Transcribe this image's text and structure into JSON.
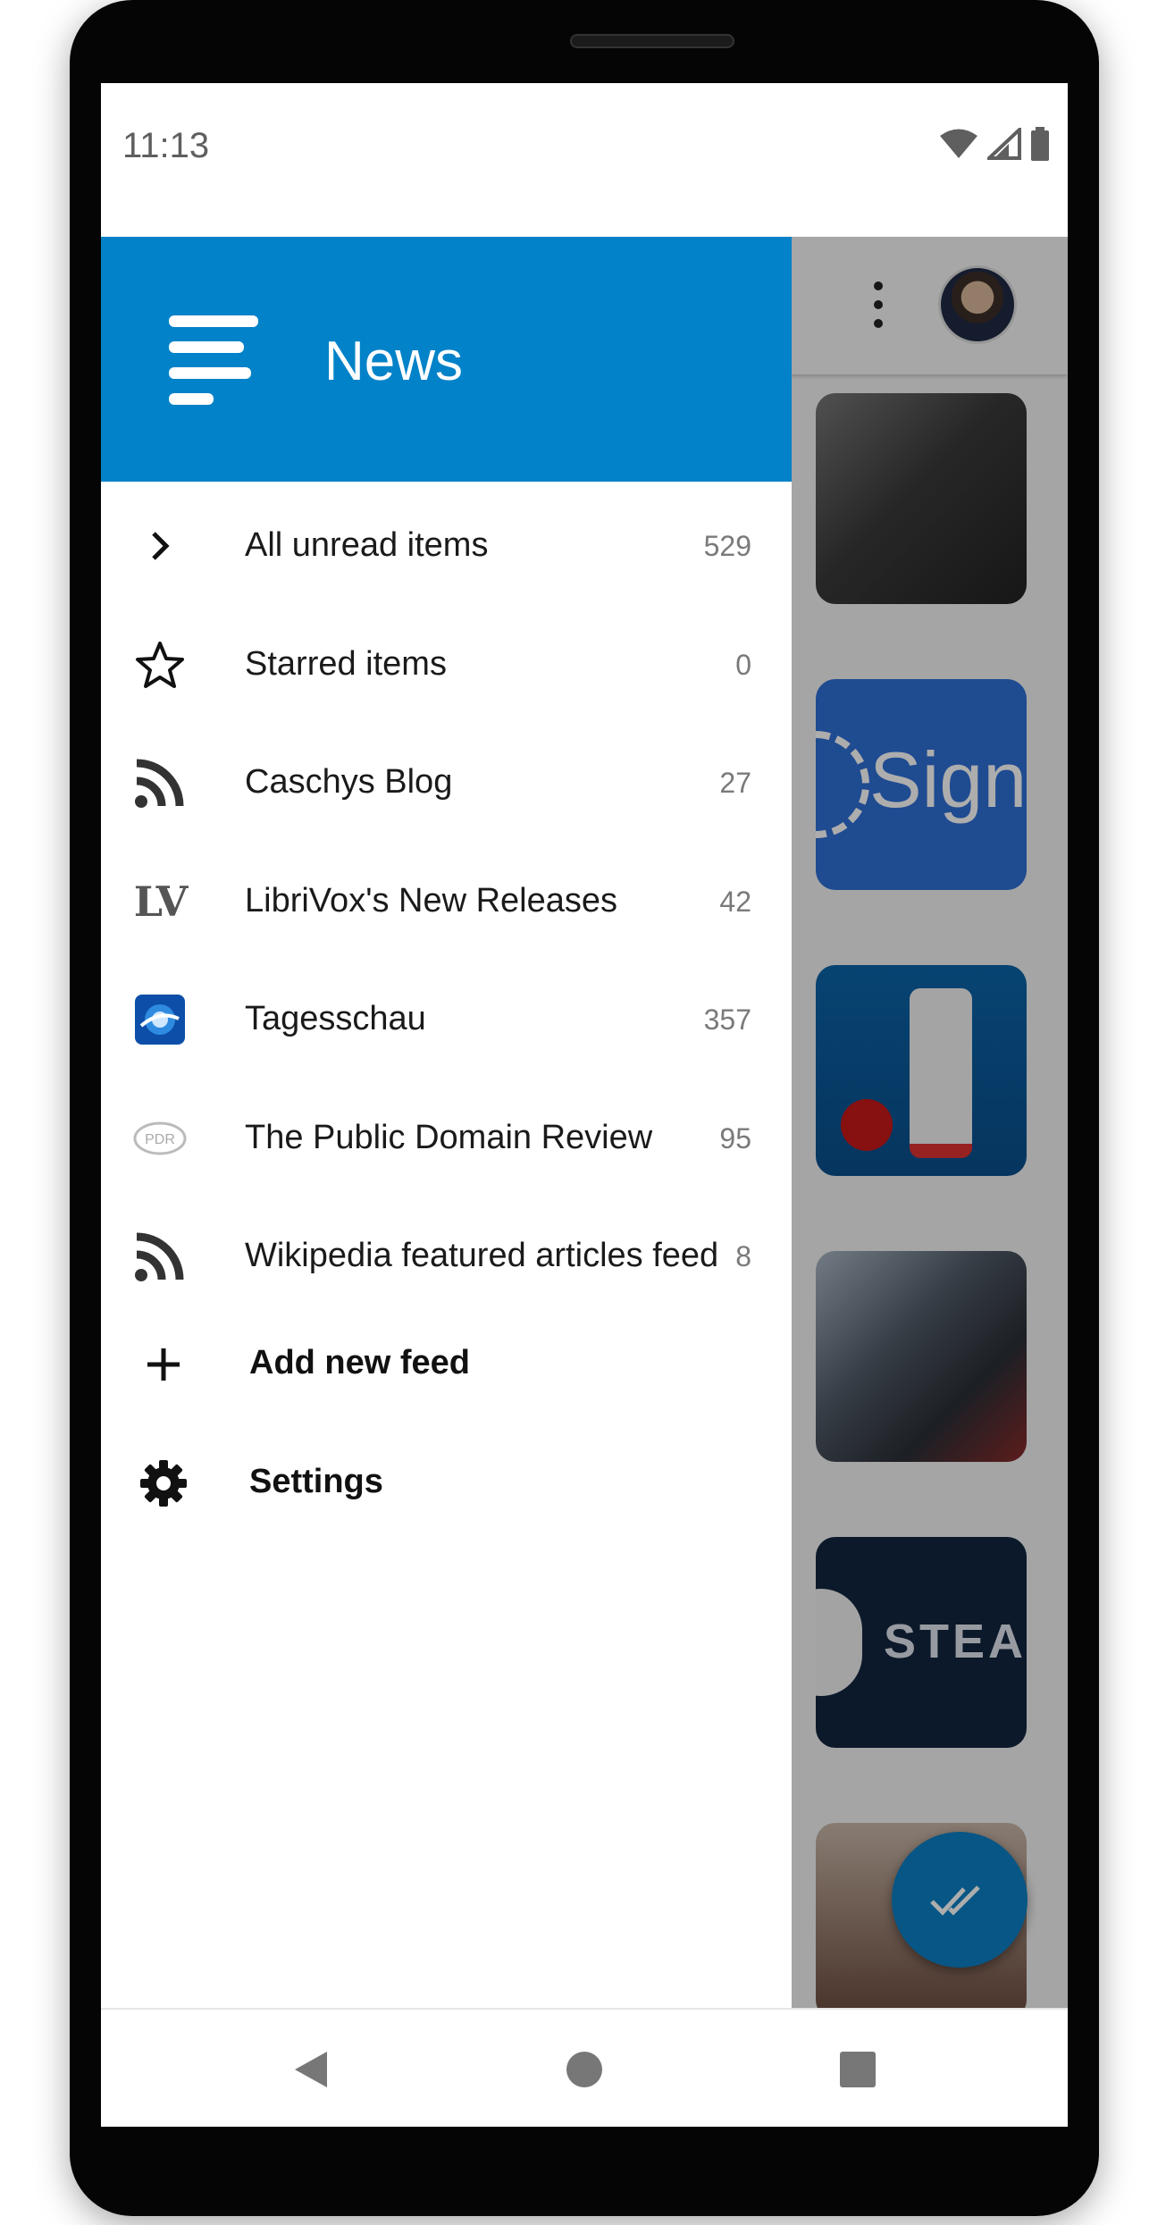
{
  "status_bar": {
    "time": "11:13"
  },
  "drawer": {
    "app_title": "News",
    "feeds": [
      {
        "icon": "chevron-right-icon",
        "label": "All unread items",
        "count": "529"
      },
      {
        "icon": "star-outline-icon",
        "label": "Starred items",
        "count": "0"
      },
      {
        "icon": "rss-icon",
        "label": "Caschys Blog",
        "count": "27"
      },
      {
        "icon": "librivox-logo-icon",
        "label": "LibriVox's New Releases",
        "count": "42",
        "icon_text": "LV"
      },
      {
        "icon": "tagesschau-logo-icon",
        "label": "Tagesschau",
        "count": "357"
      },
      {
        "icon": "public-domain-review-logo-icon",
        "label": "The Public Domain Review",
        "count": "95",
        "icon_text": "PDR"
      },
      {
        "icon": "rss-icon",
        "label": "Wikipedia featured articles feed",
        "count": "8"
      }
    ],
    "actions": [
      {
        "icon": "plus-icon",
        "label": "Add new feed"
      },
      {
        "icon": "gear-icon",
        "label": "Settings"
      }
    ]
  },
  "background": {
    "thumb_texts": {
      "signal": "Sign",
      "steam": "STEA"
    },
    "fab_icon": "double-check-icon"
  },
  "navigation": {
    "back_icon": "back-triangle-icon",
    "home_icon": "home-circle-icon",
    "recents_icon": "recents-square-icon"
  },
  "colors": {
    "accent": "#0282c8",
    "scrim": "rgba(0,0,0,0.32)"
  }
}
